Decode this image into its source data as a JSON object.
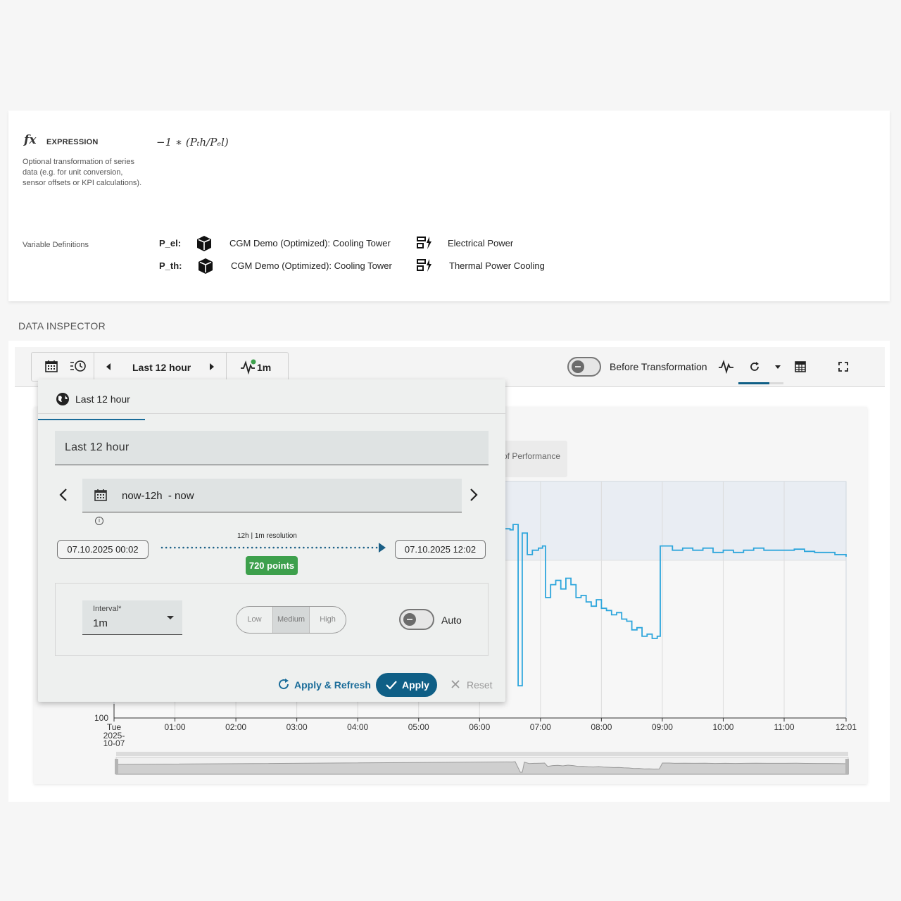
{
  "expression": {
    "label": "EXPRESSION",
    "description": "Optional transformation of series data (e.g. for unit conversion, sensor offsets or KPI calculations).",
    "formula": "−1 ∗ (Pₜh/Pₑl)"
  },
  "variables": {
    "label": "Variable Definitions",
    "items": [
      {
        "name": "P_el:",
        "asset": "CGM Demo (Optimized): Cooling Tower",
        "aspect": "Electrical Power"
      },
      {
        "name": "P_th:",
        "asset": "CGM Demo (Optimized): Cooling Tower",
        "aspect": "Thermal Power Cooling"
      }
    ]
  },
  "inspector": {
    "title": "DATA INSPECTOR",
    "range_label": "Last 12 hour",
    "resolution_label": "1m",
    "before_transformation_label": "Before Transformation",
    "before_transformation_on": false,
    "legend_fragment": "of Performance"
  },
  "popup": {
    "tab_label": "Last 12 hour",
    "preset_value": "Last 12 hour",
    "range_expression": "now-12h  - now",
    "start": "07.10.2025 00:02",
    "end": "07.10.2025 12:02",
    "resolution_text": "12h | 1m resolution",
    "points_badge": "720 points",
    "interval_label": "Interval*",
    "interval_value": "1m",
    "quality_options": [
      "Low",
      "Medium",
      "High"
    ],
    "quality_selected": "Medium",
    "auto_label": "Auto",
    "auto_on": false,
    "apply_refresh_label": "Apply & Refresh",
    "apply_label": "Apply",
    "reset_label": "Reset"
  },
  "colors": {
    "accent": "#0f5f86",
    "series": "#2ea6dc",
    "badge": "#3da04c"
  },
  "chart_data": {
    "type": "line",
    "y_tick_visible": "100",
    "x_ticks": [
      "Tue",
      "01:00",
      "02:00",
      "03:00",
      "04:00",
      "05:00",
      "06:00",
      "07:00",
      "08:00",
      "09:00",
      "10:00",
      "11:00",
      "12:01"
    ],
    "x_first_date_lines": [
      "2025-",
      "10-07"
    ],
    "series": [
      {
        "x": [
          "06:25",
          "06:30",
          "06:33",
          "06:38",
          "06:40",
          "06:42",
          "06:47",
          "06:52",
          "06:58",
          "07:02",
          "07:05",
          "07:10",
          "07:15",
          "07:20",
          "07:25",
          "07:30",
          "07:35",
          "07:40",
          "07:45",
          "07:50",
          "07:55",
          "08:00",
          "08:05",
          "08:10",
          "08:15",
          "08:20",
          "08:25",
          "08:30",
          "08:35",
          "08:40",
          "08:45",
          "08:50",
          "08:55",
          "08:58",
          "09:00",
          "09:05",
          "09:10",
          "09:20",
          "09:30",
          "09:40",
          "09:50",
          "10:00",
          "10:10",
          "10:20",
          "10:30",
          "10:40",
          "10:50",
          "11:00",
          "11:10",
          "11:20",
          "11:30",
          "11:40",
          "11:50",
          "12:01"
        ],
        "y": [
          1880,
          1875,
          1900,
          1150,
          1150,
          1860,
          1760,
          1780,
          1790,
          1800,
          1560,
          1620,
          1640,
          1600,
          1650,
          1620,
          1560,
          1570,
          1540,
          1520,
          1550,
          1510,
          1500,
          1480,
          1490,
          1460,
          1450,
          1410,
          1420,
          1380,
          1390,
          1370,
          1380,
          1800,
          1800,
          1800,
          1780,
          1790,
          1780,
          1790,
          1770,
          1780,
          1770,
          1780,
          1790,
          1780,
          1780,
          1780,
          1785,
          1775,
          1770,
          1770,
          1760,
          1750
        ]
      }
    ]
  }
}
